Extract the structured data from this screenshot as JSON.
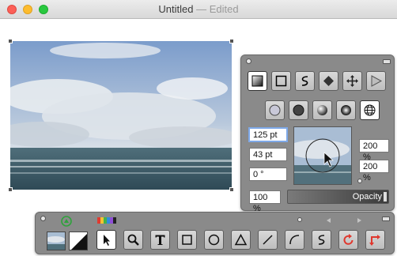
{
  "window": {
    "title": "Untitled",
    "status": "— Edited"
  },
  "colors": {
    "palette_bg": "#8a8a8a",
    "accent_focus": "#7ea9e8",
    "close": "#fc5f57",
    "minimize": "#fdbc2e",
    "maximize": "#29c83f",
    "arrow_red": "#e0372d"
  },
  "inspector": {
    "shape_tools": [
      {
        "name": "gradient-fill-icon",
        "selected": true
      },
      {
        "name": "square-icon",
        "selected": false
      },
      {
        "name": "s-curve-icon",
        "selected": false
      },
      {
        "name": "diamond-icon",
        "selected": false
      },
      {
        "name": "move-arrows-icon",
        "selected": false
      },
      {
        "name": "play-triangle-icon",
        "selected": false
      }
    ],
    "fill_styles": [
      "outline-circle-icon",
      "solid-circle-icon",
      "shaded-sphere-icon",
      "radial-gradient-icon",
      "globe-icon"
    ],
    "fields": {
      "size": "125 pt",
      "radius": "43 pt",
      "angle": "0 °",
      "opacity_value": "100 %",
      "scale_x": "200 %",
      "scale_y": "200 %"
    },
    "opacity_label": "Opacity"
  },
  "toolbar": {
    "tools": [
      "arrow-pointer-icon",
      "magnifier-icon",
      "text-tool-icon",
      "rectangle-tool-icon",
      "ellipse-tool-icon",
      "triangle-tool-icon",
      "line-tool-icon",
      "arc-tool-icon",
      "freehand-s-icon",
      "rotate-icon",
      "flip-arrows-icon"
    ],
    "selected_tool": "arrow-pointer-icon"
  }
}
